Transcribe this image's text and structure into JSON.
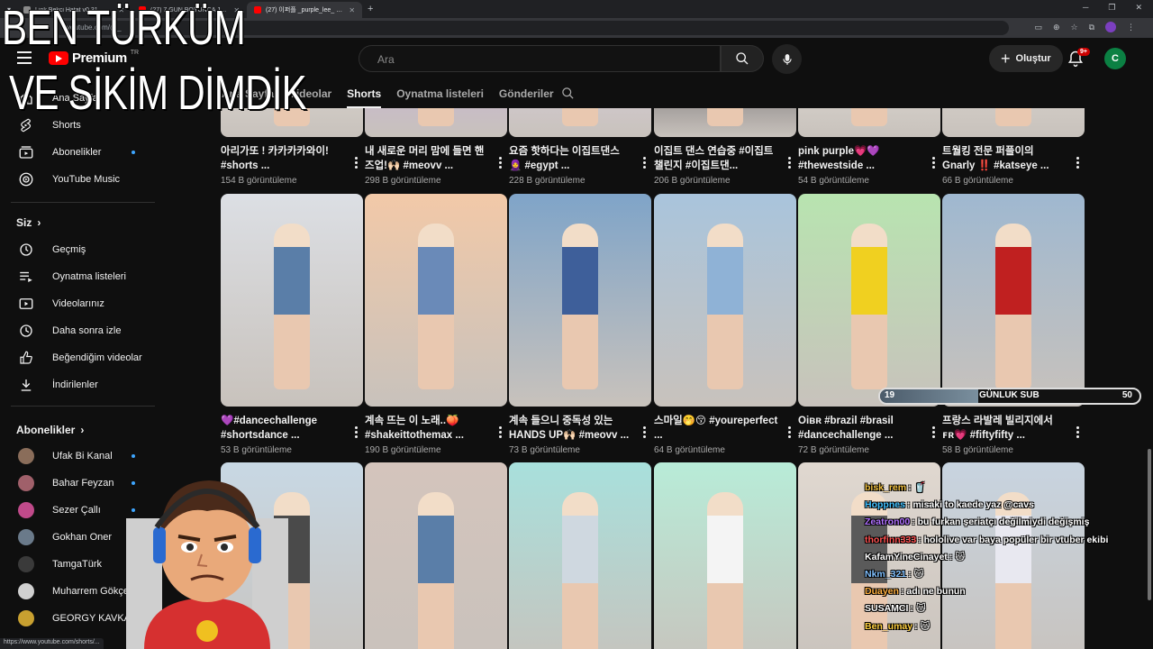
{
  "browser": {
    "tabs": [
      {
        "title": "Link Bekci Hatat v0.31",
        "active": false
      },
      {
        "title": "(27) 7 GÜN BOYUNCA JAPON...",
        "active": false
      },
      {
        "title": "(27) 이퍼플 _purple_lee_ - YouT",
        "active": true
      }
    ],
    "address": "youtube.com/@_",
    "status_url": "https://www.youtube.com/shorts/..."
  },
  "overlay": {
    "line1": "BEN TÜRKÜM",
    "line2": "VE SİKİM DİMDİK"
  },
  "header": {
    "logo_text": "Premium",
    "logo_region": "TR",
    "search_placeholder": "Ara",
    "create_label": "Oluştur",
    "notif_badge": "9+",
    "avatar_letter": "C"
  },
  "sidebar": {
    "main": [
      {
        "label": "Ana Sayfa",
        "icon": "home-icon"
      },
      {
        "label": "Shorts",
        "icon": "shorts-icon"
      },
      {
        "label": "Abonelikler",
        "icon": "subscriptions-icon",
        "dot": true
      },
      {
        "label": "YouTube Music",
        "icon": "music-icon"
      }
    ],
    "you_header": "Siz",
    "you": [
      {
        "label": "Geçmiş",
        "icon": "history-icon"
      },
      {
        "label": "Oynatma listeleri",
        "icon": "playlist-icon"
      },
      {
        "label": "Videolarınız",
        "icon": "your-videos-icon"
      },
      {
        "label": "Daha sonra izle",
        "icon": "watch-later-icon"
      },
      {
        "label": "Beğendiğim videolar",
        "icon": "like-icon"
      },
      {
        "label": "İndirilenler",
        "icon": "download-icon"
      }
    ],
    "subs_header": "Abonelikler",
    "subs": [
      {
        "label": "Ufak Bi Kanal",
        "color": "#8a6d5a"
      },
      {
        "label": "Bahar Feyzan",
        "color": "#a0606a"
      },
      {
        "label": "Sezer Çallı",
        "color": "#c04a8a"
      },
      {
        "label": "Gokhan Oner",
        "color": "#6a7a8a"
      },
      {
        "label": "TamgaTürk",
        "color": "#3a3a3a"
      },
      {
        "label": "Muharrem Gökçe",
        "color": "#d0d0d0"
      },
      {
        "label": "GEORGY KAVKA...",
        "color": "#c8a030"
      }
    ]
  },
  "channel_tabs": [
    {
      "label": "Ana Sayfa",
      "active": false
    },
    {
      "label": "Videolar",
      "active": false
    },
    {
      "label": "Shorts",
      "active": true
    },
    {
      "label": "Oynatma listeleri",
      "active": false
    },
    {
      "label": "Gönderiler",
      "active": false
    }
  ],
  "rows": [
    [
      {
        "title": "아리가또 ! 카카카카와이! #shorts ...",
        "views": "154 B görüntüleme",
        "bg": "#e8e4df",
        "fig": "#d8d2cc"
      },
      {
        "title": "내 새로운 머리 맘에 들면 핸즈업!🙌🏻 #meovv ...",
        "views": "298 B görüntüleme",
        "bg": "#c9a8e8",
        "fig": "#9b6fd6"
      },
      {
        "title": "요즘 핫하다는 이집트댄스 🧕 #egypt ...",
        "views": "228 B görüntüleme",
        "bg": "#e3d5f0",
        "fig": "#b78ae0"
      },
      {
        "title": "이집트 댄스 연습중 #이집트챌린지 #이집트댄...",
        "views": "206 B görüntüleme",
        "bg": "#2a2a33",
        "fig": "#777"
      },
      {
        "title": "pink purple💗💜 #thewestside ...",
        "views": "54 B görüntüleme",
        "bg": "#f0ece6",
        "fig": "#8a8a8a"
      },
      {
        "title": "트월킹 전문 퍼플이의 Gnarly ‼️ #katseye ...",
        "views": "66 B görüntüleme",
        "bg": "#e9e4de",
        "fig": "#5a5a5a"
      }
    ],
    [
      {
        "title": "💜#dancechallenge #shortsdance ...",
        "views": "53 B görüntüleme",
        "bg": "#dcdfe4",
        "fig": "#5a7ea8"
      },
      {
        "title": "계속 뜨는 이 노래..🍑 #shakeittothemax ...",
        "views": "190 B görüntüleme",
        "bg": "#f2c9a8",
        "fig": "#6a8ab8"
      },
      {
        "title": "계속 들으니 중독성 있는 HANDS UP🙌🏻 #meovv ...",
        "views": "73 B görüntüleme",
        "bg": "#7fa4c8",
        "fig": "#3e5f9a"
      },
      {
        "title": "스마일🤭😚 #youreperfect ...",
        "views": "64 B görüntüleme",
        "bg": "#a9c4dc",
        "fig": "#8fb2d6"
      },
      {
        "title": "Oiʙʀ #brazil #brasil #dancechallenge ...",
        "views": "72 B görüntüleme",
        "bg": "#b8e4b0",
        "fig": "#f0d020"
      },
      {
        "title": "프랑스 라발레 빌리지에서 ꜰʀ💗 #fiftyfifty ...",
        "views": "58 B görüntüleme",
        "bg": "#9fb8d0",
        "fig": "#c02020"
      }
    ],
    [
      {
        "title": "",
        "views": "",
        "bg": "#c8d8e4",
        "fig": "#4a4a4a"
      },
      {
        "title": "",
        "views": "",
        "bg": "#d4c4bc",
        "fig": "#5a7ea8"
      },
      {
        "title": "",
        "views": "",
        "bg": "#a8e0dc",
        "fig": "#cfd8e0"
      },
      {
        "title": "",
        "views": "",
        "bg": "#b8ecd8",
        "fig": "#f4f4f4"
      },
      {
        "title": "",
        "views": "",
        "bg": "#e0d8d0",
        "fig": "#5a5a5a"
      },
      {
        "title": "",
        "views": "",
        "bg": "#c8d4e0",
        "fig": "#e8e8f0"
      }
    ]
  ],
  "sub_goal": {
    "current": "19",
    "label": "GÜNLUK SUB",
    "target": "50",
    "progress": 0.38
  },
  "chat": [
    {
      "user": "bisk_rem",
      "color": "#f0c040",
      "msg": "🥤"
    },
    {
      "user": "Hoppnes",
      "color": "#40c0ff",
      "msg": "misaki to kaede yaz @cavs"
    },
    {
      "user": "Zeatron00",
      "color": "#b070ff",
      "msg": "bu furkan şeriatçı değilmiydi değişmiş"
    },
    {
      "user": "thorfinn333",
      "color": "#ff5050",
      "msg": "hololive var baya popüler bir vtuber ekibi"
    },
    {
      "user": "KafamYineCinayet",
      "color": "#ffffff",
      "msg": "🐱"
    },
    {
      "user": "Nkm_321",
      "color": "#80c0ff",
      "msg": "🐱"
    },
    {
      "user": "Duayen",
      "color": "#ffb040",
      "msg": "adı ne bunun"
    },
    {
      "user": "SUSAMCI",
      "color": "#ffffff",
      "msg": "🐱"
    },
    {
      "user": "Ben_umay",
      "color": "#ffd040",
      "msg": "🐱"
    }
  ]
}
